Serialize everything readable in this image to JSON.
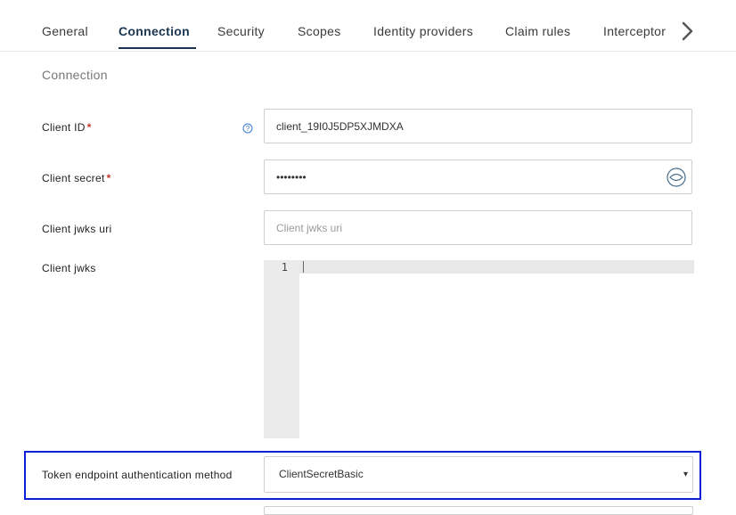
{
  "tabs": [
    {
      "label": "General"
    },
    {
      "label": "Connection"
    },
    {
      "label": "Security"
    },
    {
      "label": "Scopes"
    },
    {
      "label": "Identity providers"
    },
    {
      "label": "Claim rules"
    },
    {
      "label": "Interceptor"
    }
  ],
  "active_tab": "Connection",
  "section": {
    "title": "Connection"
  },
  "fields": {
    "client_id": {
      "label": "Client ID",
      "required_mark": "*",
      "value": "client_19I0J5DP5XJMDXA"
    },
    "client_secret": {
      "label": "Client secret",
      "required_mark": "*",
      "value": "••••••••"
    },
    "client_jwks_uri": {
      "label": "Client jwks uri",
      "placeholder": "Client jwks uri",
      "value": ""
    },
    "client_jwks": {
      "label": "Client jwks",
      "line_number": "1"
    },
    "token_auth_method": {
      "label": "Token endpoint authentication method",
      "value": "ClientSecretBasic",
      "arrow": "▾"
    }
  },
  "icons": {
    "help": "question-circle-icon",
    "eye": "eye-icon",
    "next": "chevron-right-icon"
  },
  "colors": {
    "active_tab": "#1a3550",
    "required": "#c0392b",
    "highlight_border": "#0b1fd6",
    "help_icon": "#3a7bd5"
  }
}
